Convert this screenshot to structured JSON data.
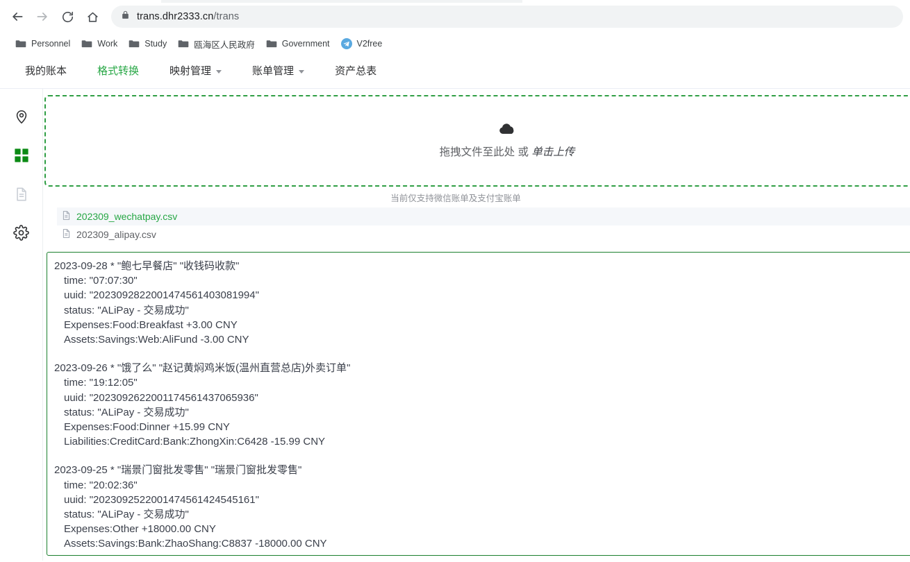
{
  "browser": {
    "back_icon": "arrow-left-icon",
    "forward_icon": "arrow-right-icon",
    "reload_icon": "reload-icon",
    "home_icon": "home-icon",
    "lock_icon": "lock-icon",
    "url_host": "trans.dhr2333.cn",
    "url_path": "/trans",
    "bookmarks": [
      {
        "label": "Personnel",
        "icon": "folder-icon"
      },
      {
        "label": "Work",
        "icon": "folder-icon"
      },
      {
        "label": "Study",
        "icon": "folder-icon"
      },
      {
        "label": "瓯海区人民政府",
        "icon": "folder-icon"
      },
      {
        "label": "Government",
        "icon": "folder-icon"
      },
      {
        "label": "V2free",
        "icon": "paper-plane-icon"
      }
    ]
  },
  "topnav": {
    "items": [
      {
        "label": "我的账本",
        "active": false,
        "has_caret": false
      },
      {
        "label": "格式转换",
        "active": true,
        "has_caret": false
      },
      {
        "label": "映射管理",
        "active": false,
        "has_caret": true
      },
      {
        "label": "账单管理",
        "active": false,
        "has_caret": true
      },
      {
        "label": "资产总表",
        "active": false,
        "has_caret": false
      }
    ]
  },
  "sidebar": {
    "items": [
      {
        "name": "location-pin-icon",
        "label": "定位"
      },
      {
        "name": "grid-icon",
        "label": "格式转换"
      },
      {
        "name": "document-icon",
        "label": "文档"
      },
      {
        "name": "gear-icon",
        "label": "设置"
      }
    ]
  },
  "upload": {
    "icon": "cloud-upload-icon",
    "text_main": "拖拽文件至此处 或 ",
    "text_em": "单击上传",
    "hint": "当前仅支持微信账单及支付宝账单"
  },
  "files": [
    {
      "name": "202309_wechatpay.csv",
      "icon": "file-document-icon",
      "selected": true
    },
    {
      "name": "202309_alipay.csv",
      "icon": "file-document-icon",
      "selected": false
    }
  ],
  "editor": {
    "transactions": [
      {
        "header": "2023-09-28 * \"鲍七早餐店\" \"收钱码收款\"",
        "lines": [
          "time: \"07:07:30\"",
          "uuid: \"2023092822001474561403081994\"",
          "status: \"ALiPay - 交易成功\"",
          "Expenses:Food:Breakfast +3.00 CNY",
          "Assets:Savings:Web:AliFund -3.00 CNY"
        ]
      },
      {
        "header": "2023-09-26 * \"饿了么\" \"赵记黄焖鸡米饭(温州直营总店)外卖订单\"",
        "lines": [
          "time: \"19:12:05\"",
          "uuid: \"2023092622001174561437065936\"",
          "status: \"ALiPay - 交易成功\"",
          "Expenses:Food:Dinner +15.99 CNY",
          "Liabilities:CreditCard:Bank:ZhongXin:C6428 -15.99 CNY"
        ]
      },
      {
        "header": "2023-09-25 * \"瑞景门窗批发零售\" \"瑞景门窗批发零售\"",
        "lines": [
          "time: \"20:02:36\"",
          "uuid: \"2023092522001474561424545161\"",
          "status: \"ALiPay - 交易成功\"",
          "Expenses:Other +18000.00 CNY",
          "Assets:Savings:Bank:ZhaoShang:C8837 -18000.00 CNY"
        ]
      }
    ]
  },
  "colors": {
    "accent_green": "#27a745",
    "border_green": "#2f9e44",
    "editor_border": "#1a7f2e"
  }
}
